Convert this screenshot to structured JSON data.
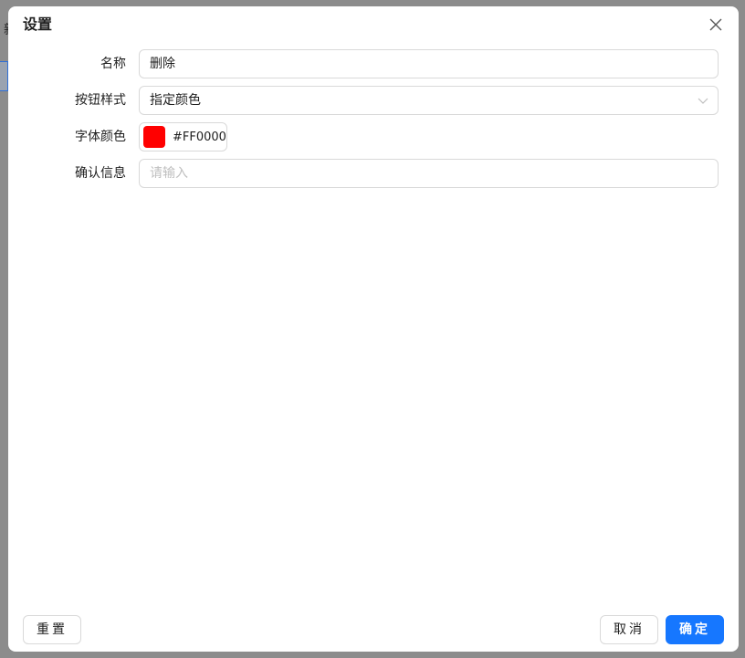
{
  "background": {
    "peek_char": "新"
  },
  "dialog": {
    "title": "设置",
    "close_icon": "close-icon"
  },
  "form": {
    "name": {
      "label": "名称",
      "value": "删除"
    },
    "button_style": {
      "label": "按钮样式",
      "value": "指定颜色",
      "icon": "chevron-down-icon"
    },
    "font_color": {
      "label": "字体颜色",
      "value": "#FF0000",
      "swatch_color": "#FF0000"
    },
    "confirm_message": {
      "label": "确认信息",
      "value": "",
      "placeholder": "请输入"
    }
  },
  "footer": {
    "reset_label": "重置",
    "cancel_label": "取消",
    "ok_label": "确定"
  },
  "colors": {
    "primary": "#1677ff",
    "overlay": "#8c8c8c"
  }
}
